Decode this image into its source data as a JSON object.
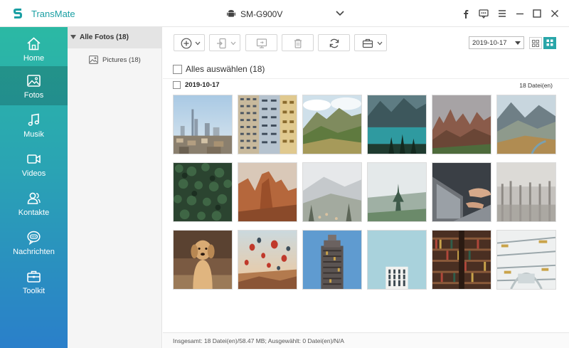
{
  "app": {
    "title": "TransMate",
    "brand_color": "#1a9fa3"
  },
  "device": {
    "name": "SM-G900V"
  },
  "sidebar": {
    "items": [
      {
        "label": "Home",
        "icon": "home-icon",
        "active": false
      },
      {
        "label": "Fotos",
        "icon": "photo-icon",
        "active": true
      },
      {
        "label": "Musik",
        "icon": "music-icon",
        "active": false
      },
      {
        "label": "Videos",
        "icon": "video-icon",
        "active": false
      },
      {
        "label": "Kontakte",
        "icon": "contacts-icon",
        "active": false
      },
      {
        "label": "Nachrichten",
        "icon": "messages-icon",
        "active": false
      },
      {
        "label": "Toolkit",
        "icon": "toolkit-icon",
        "active": false
      }
    ]
  },
  "tree": {
    "root": "Alle Fotos (18)",
    "children": [
      "Pictures (18)"
    ]
  },
  "toolbar": {
    "date_filter": "2019-10-17"
  },
  "select_all": {
    "label": "Alles auswählen (18)"
  },
  "group": {
    "date": "2019-10-17",
    "count": "18 Datei(en)"
  },
  "photos": [
    {
      "subject": "city-skyline"
    },
    {
      "subject": "apartment-building"
    },
    {
      "subject": "green-mountains"
    },
    {
      "subject": "mountain-lake"
    },
    {
      "subject": "rock-formations"
    },
    {
      "subject": "misty-valley"
    },
    {
      "subject": "forest-aerial"
    },
    {
      "subject": "red-canyon"
    },
    {
      "subject": "foggy-hills"
    },
    {
      "subject": "misty-pine"
    },
    {
      "subject": "laptop-hands"
    },
    {
      "subject": "foggy-forest"
    },
    {
      "subject": "dog"
    },
    {
      "subject": "hot-air-balloons"
    },
    {
      "subject": "skyscraper"
    },
    {
      "subject": "white-building"
    },
    {
      "subject": "library-shelves"
    },
    {
      "subject": "library-atrium"
    }
  ],
  "status": {
    "text": "Insgesamt: 18 Datei(en)/58.47 MB; Ausgewählt: 0 Datei(en)/N/A"
  }
}
